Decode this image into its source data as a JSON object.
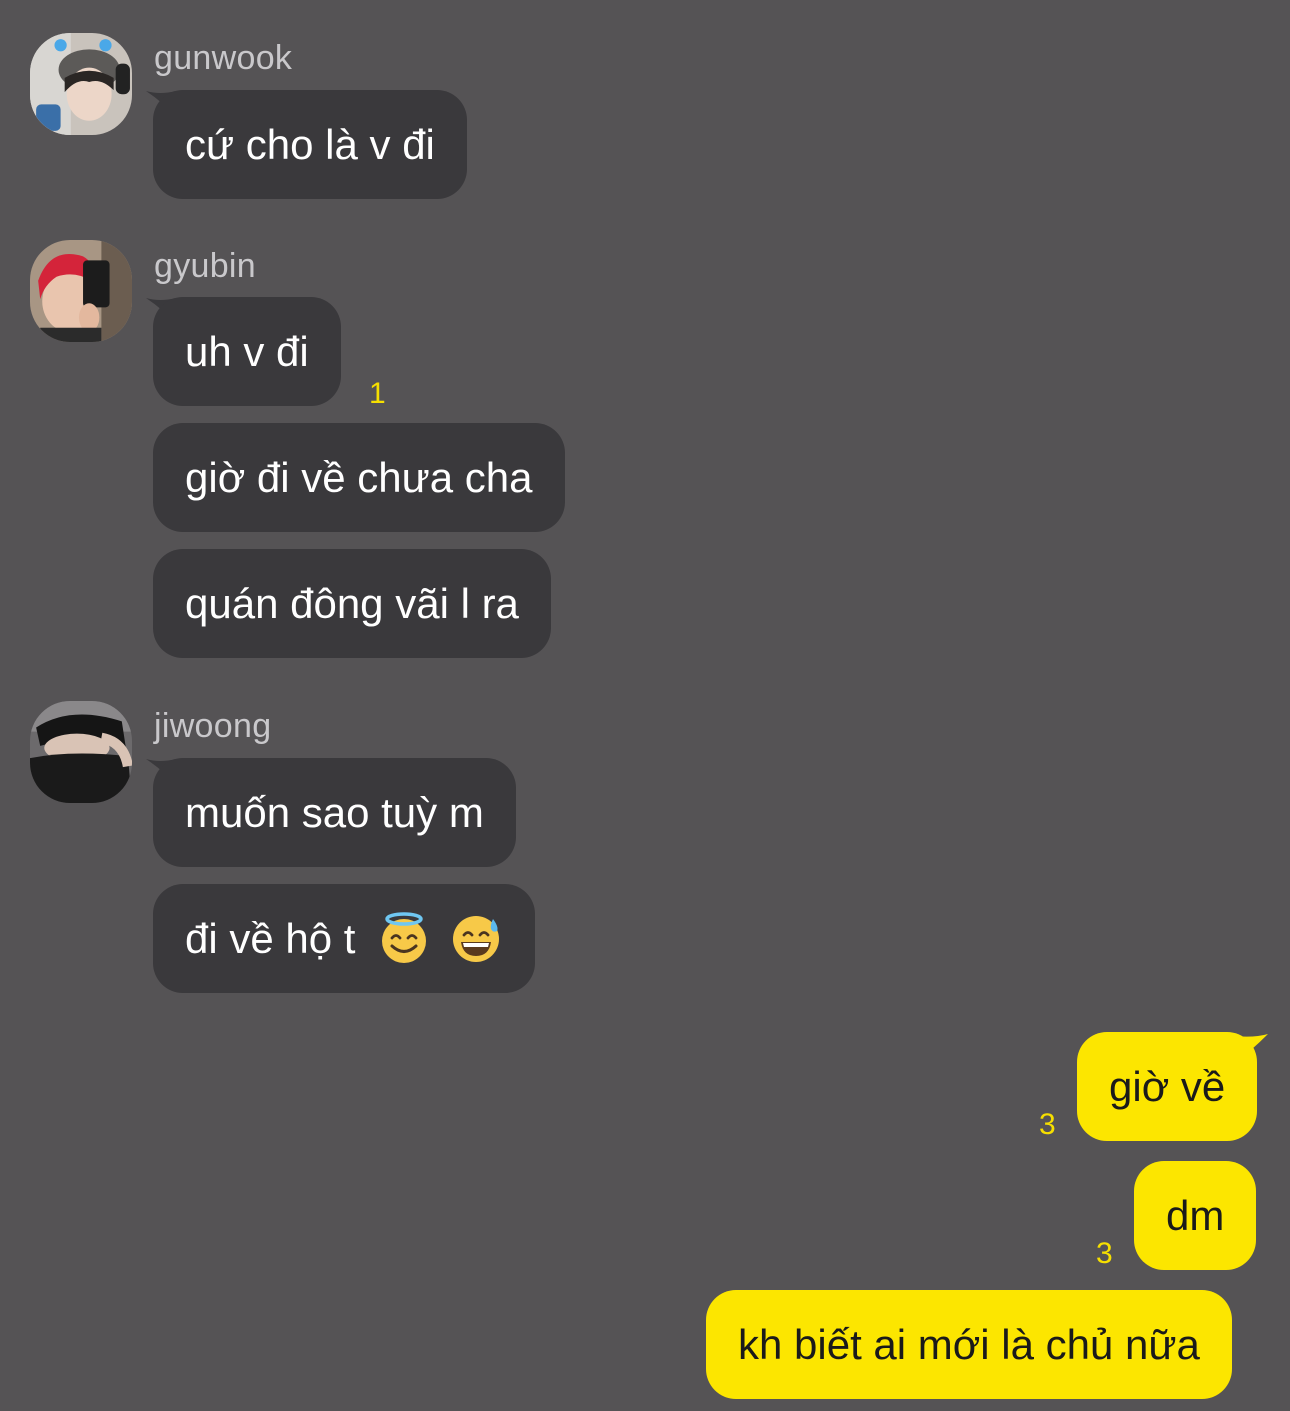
{
  "colors": {
    "background": "#555355",
    "incoming_bubble": "#3a393c",
    "outgoing_bubble": "#fce600",
    "unread_count": "#f6df00"
  },
  "messages": {
    "gunwook": {
      "sender": "gunwook",
      "avatar": "avatar-icon",
      "msg1": "cứ cho là v đi"
    },
    "gyubin": {
      "sender": "gyubin",
      "avatar": "avatar-icon",
      "msg1": "uh v đi",
      "msg1_unread": "1",
      "msg2": "giờ đi về chưa cha",
      "msg3": "quán đông vãi l ra"
    },
    "jiwoong": {
      "sender": "jiwoong",
      "avatar": "avatar-icon",
      "msg1": "muốn sao tuỳ m",
      "msg2_text": "đi về hộ t",
      "msg2_emojis": [
        "smiling-face-with-halo-icon",
        "grinning-face-with-sweat-icon"
      ]
    },
    "me": {
      "msg1": "giờ về",
      "msg1_unread": "3",
      "msg2": "dm",
      "msg2_unread": "3",
      "msg3": "kh biết ai mới là chủ nữa"
    }
  }
}
